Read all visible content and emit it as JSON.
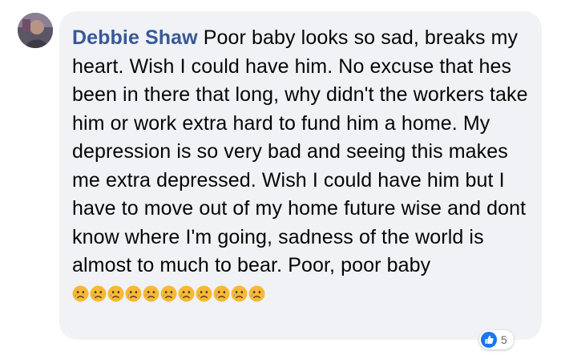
{
  "comment": {
    "author": "Debbie Shaw",
    "text": "Poor baby looks so sad, breaks my heart. Wish I could have him. No excuse that hes been in there that long, why didn't the workers take him or work extra hard to fund him a home. My depression is so very bad and seeing this makes me extra depressed. Wish I could have him but I have to move out of my home future wise and dont know where I'm going, sadness of the world is almost to much to bear. Poor, poor baby",
    "emoji_name": "crying-face-icon",
    "emoji_count": 11,
    "reactions": {
      "icon": "like-icon",
      "count": "5"
    }
  },
  "colors": {
    "author": "#385898",
    "bubble": "#f0f2f5",
    "text": "#050505",
    "like": "#1877f2",
    "emoji": "#f7b935"
  }
}
